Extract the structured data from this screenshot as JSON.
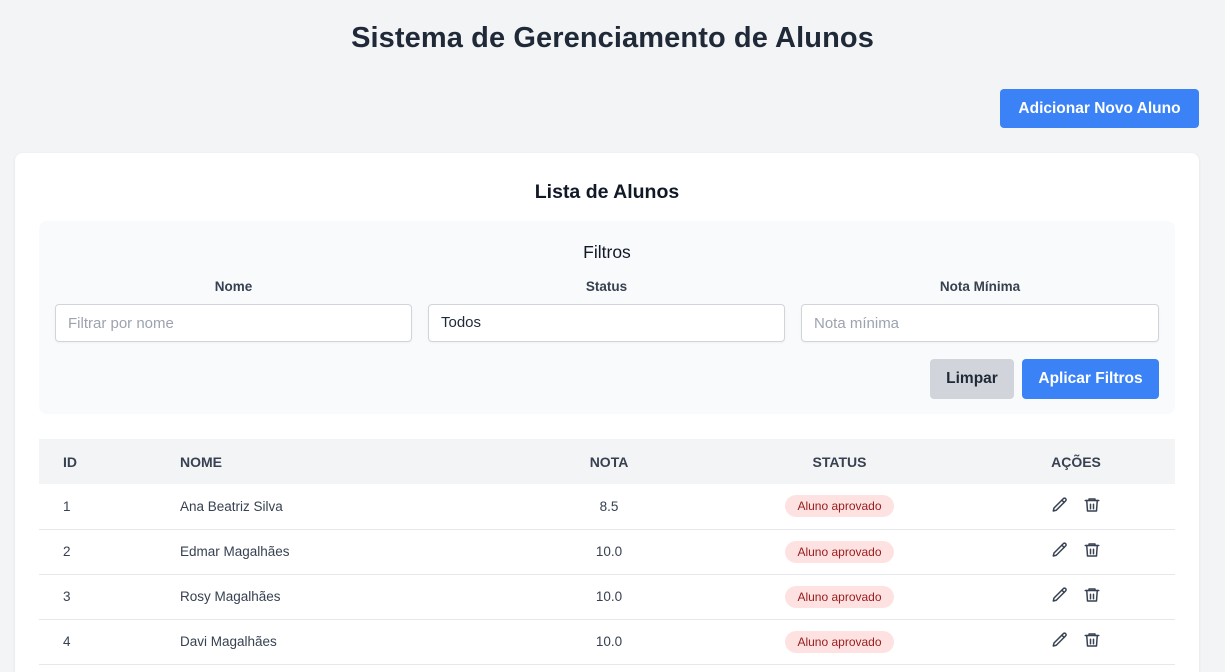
{
  "header": {
    "title": "Sistema de Gerenciamento de Alunos",
    "add_button": "Adicionar Novo Aluno"
  },
  "list": {
    "title": "Lista de Alunos",
    "filters": {
      "title": "Filtros",
      "name_label": "Nome",
      "name_placeholder": "Filtrar por nome",
      "name_value": "",
      "status_label": "Status",
      "status_value": "Todos",
      "min_grade_label": "Nota Mínima",
      "min_grade_placeholder": "Nota mínima",
      "min_grade_value": "",
      "clear_button": "Limpar",
      "apply_button": "Aplicar Filtros"
    },
    "columns": [
      "ID",
      "Nome",
      "Nota",
      "Status",
      "Ações"
    ],
    "rows": [
      {
        "id": "1",
        "nome": "Ana Beatriz Silva",
        "nota": "8.5",
        "status": "Aluno aprovado"
      },
      {
        "id": "2",
        "nome": "Edmar Magalhães",
        "nota": "10.0",
        "status": "Aluno aprovado"
      },
      {
        "id": "3",
        "nome": "Rosy Magalhães",
        "nota": "10.0",
        "status": "Aluno aprovado"
      },
      {
        "id": "4",
        "nome": "Davi Magalhães",
        "nota": "10.0",
        "status": "Aluno aprovado"
      }
    ],
    "icons": {
      "edit": "pencil-icon",
      "delete": "trash-icon"
    }
  },
  "colors": {
    "primary": "#3b82f6",
    "background": "#f3f4f6",
    "badge_bg": "#fee2e2",
    "badge_text": "#991b1b"
  }
}
